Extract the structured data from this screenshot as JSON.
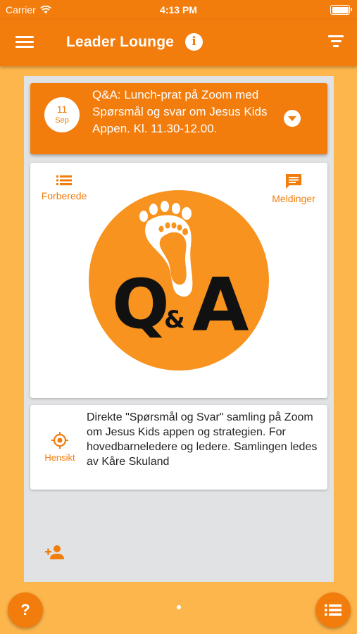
{
  "status_bar": {
    "carrier": "Carrier",
    "time": "4:13 PM"
  },
  "app_bar": {
    "title": "Leader Lounge",
    "info_glyph": "i",
    "menu_icon": "hamburger-menu-icon",
    "filter_icon": "filter-icon"
  },
  "event": {
    "day": "11",
    "month": "Sep",
    "title": "Q&A: Lunch-prat på Zoom med Spørsmål og svar om Jesus Kids Appen. Kl. 11.30-12.00.",
    "expand_icon": "chevron-down-circle-icon"
  },
  "image_card": {
    "prepare_label": "Forberede",
    "prepare_icon": "list-icon",
    "messages_label": "Meldinger",
    "messages_icon": "message-icon",
    "logo": {
      "icon": "footprints-icon",
      "q": "Q",
      "amp": "&",
      "a": "A"
    }
  },
  "purpose": {
    "label": "Hensikt",
    "icon": "target-icon",
    "description": "Direkte \"Spørsmål og Svar\" samling på Zoom om Jesus Kids appen og strategien. For hovedbarneledere og ledere. Samlingen ledes av Kåre Skuland"
  },
  "bottom": {
    "add_user_icon": "add-user-icon",
    "help_glyph": "?",
    "list_icon": "list-icon"
  },
  "colors": {
    "accent": "#F27C0C",
    "background": "#FDB64C",
    "panel": "#E1E2E4",
    "logo_circle": "#F7931E"
  }
}
